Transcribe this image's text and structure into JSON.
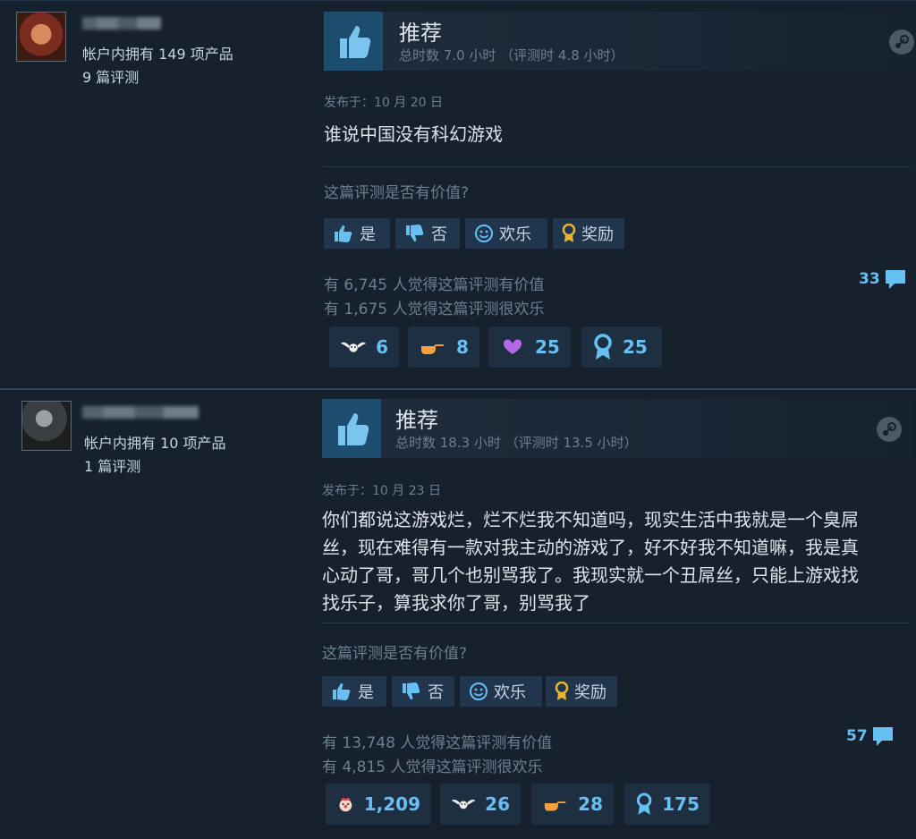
{
  "reviews": [
    {
      "reviewer": {
        "products_owned": "帐户内拥有 149 项产品",
        "review_count": "9 篇评测"
      },
      "verdict": "推荐",
      "playtime": "总时数 7.0 小时 （评测时 4.8 小时）",
      "posted": "发布于：10 月 20 日",
      "content": [
        "谁说中国没有科幻游戏"
      ],
      "helpful_question": "这篇评测是否有价值?",
      "buttons": {
        "yes": "是",
        "no": "否",
        "funny": "欢乐",
        "award": "奖励"
      },
      "helpful_stat": "有 6,745 人觉得这篇评测有价值",
      "funny_stat": "有 1,675 人觉得这篇评测很欢乐",
      "comments": "33",
      "awards": [
        {
          "icon": "wings-award-icon",
          "count": "6"
        },
        {
          "icon": "pointing-hand-award-icon",
          "count": "8"
        },
        {
          "icon": "heart-hands-award-icon",
          "count": "25"
        },
        {
          "icon": "medal-award-icon",
          "count": "25"
        }
      ]
    },
    {
      "reviewer": {
        "products_owned": "帐户内拥有 10 项产品",
        "review_count": "1 篇评测"
      },
      "verdict": "推荐",
      "playtime": "总时数 18.3 小时 （评测时 13.5 小时）",
      "posted": "发布于：10 月 23 日",
      "content": [
        "你们都说这游戏烂，烂不烂我不知道吗，现实生活中我就是一个臭屌",
        "丝，现在难得有一款对我主动的游戏了，好不好我不知道嘛，我是真",
        "心动了哥，哥几个也别骂我了。我现实就一个丑屌丝，只能上游戏找",
        "找乐子，算我求你了哥，别骂我了"
      ],
      "helpful_question": "这篇评测是否有价值?",
      "buttons": {
        "yes": "是",
        "no": "否",
        "funny": "欢乐",
        "award": "奖励"
      },
      "helpful_stat": "有 13,748 人觉得这篇评测有价值",
      "funny_stat": "有 4,815 人觉得这篇评测很欢乐",
      "comments": "57",
      "awards": [
        {
          "icon": "clown-award-icon",
          "count": "1,209"
        },
        {
          "icon": "wings-award-icon",
          "count": "26"
        },
        {
          "icon": "pointing-hand-award-icon",
          "count": "28"
        },
        {
          "icon": "medal-award-icon",
          "count": "175"
        }
      ]
    }
  ],
  "colors": {
    "accent": "#66c0f4",
    "background": "#17212e",
    "thumb_box": "#1d4d6e"
  }
}
